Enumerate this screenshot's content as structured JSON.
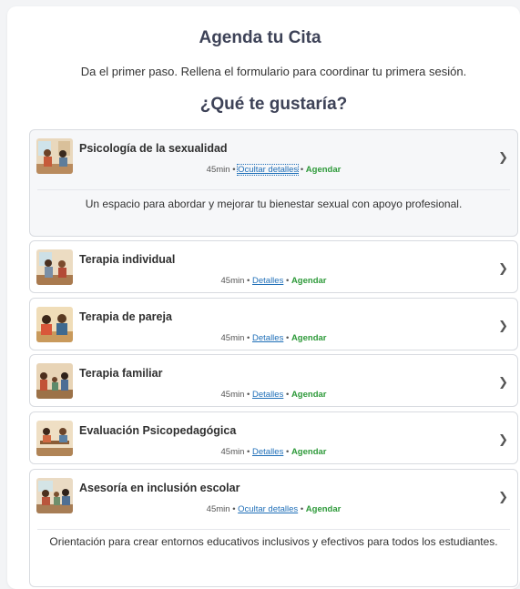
{
  "header": {
    "title": "Agenda tu Cita",
    "subtitle": "Da el primer paso. Rellena el formulario para coordinar tu primera sesión.",
    "question": "¿Qué te gustaría?"
  },
  "colors": {
    "accent_link": "#1f6fb8",
    "accent_book": "#2e9a3a",
    "heading": "#3d4257"
  },
  "services": [
    {
      "name": "Psicología de la sexualidad",
      "duration": "45min",
      "details_label": "Ocultar detalles",
      "book_label": "Agendar",
      "description": "Un espacio para abordar y mejorar tu bienestar sexual con apoyo profesional.",
      "expanded": true,
      "icon": "chevron-right-icon"
    },
    {
      "name": "Terapia individual",
      "duration": "45min",
      "details_label": "Detalles",
      "book_label": "Agendar",
      "expanded": false,
      "icon": "chevron-right-icon"
    },
    {
      "name": "Terapia de pareja",
      "duration": "45min",
      "details_label": "Detalles",
      "book_label": "Agendar",
      "expanded": false,
      "icon": "chevron-right-icon"
    },
    {
      "name": "Terapia familiar",
      "duration": "45min",
      "details_label": "Detalles",
      "book_label": "Agendar",
      "expanded": false,
      "icon": "chevron-right-icon"
    },
    {
      "name": "Evaluación Psicopedagógica",
      "duration": "45min",
      "details_label": "Detalles",
      "book_label": "Agendar",
      "expanded": false,
      "icon": "chevron-right-icon"
    },
    {
      "name": "Asesoría en inclusión escolar",
      "duration": "45min",
      "details_label": "Ocultar detalles",
      "book_label": "Agendar",
      "description": "Orientación para crear entornos educativos inclusivos y efectivos para todos los estudiantes.",
      "expanded": true,
      "icon": "chevron-right-icon"
    }
  ]
}
